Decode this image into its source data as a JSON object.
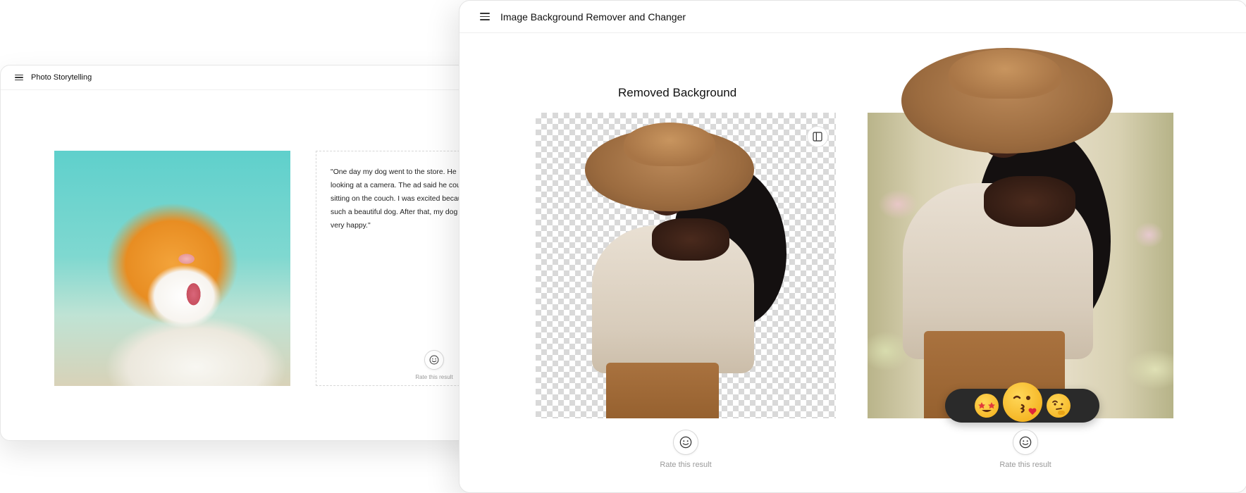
{
  "back_window": {
    "title": "Photo Storytelling",
    "story_text": "\"One day my dog went to the store. He saw an ad for a dog looking at a camera. The ad said he could take pictures while sitting on the couch. I was excited because I had never seen such a beautiful dog. After that, my dog went to work and was very happy.\"",
    "rate_label": "Rate this result"
  },
  "front_window": {
    "title": "Image Background Remover and Changer",
    "section_title": "Removed Background",
    "rate_label_left": "Rate this result",
    "rate_label_right": "Rate this result",
    "emoji_options": [
      "star-struck-emoji",
      "kiss-emoji",
      "thinking-emoji"
    ]
  },
  "colors": {
    "emoji_bar": "#2a2a2a",
    "border": "#e4e4e4",
    "muted_text": "#9a9a9a"
  }
}
